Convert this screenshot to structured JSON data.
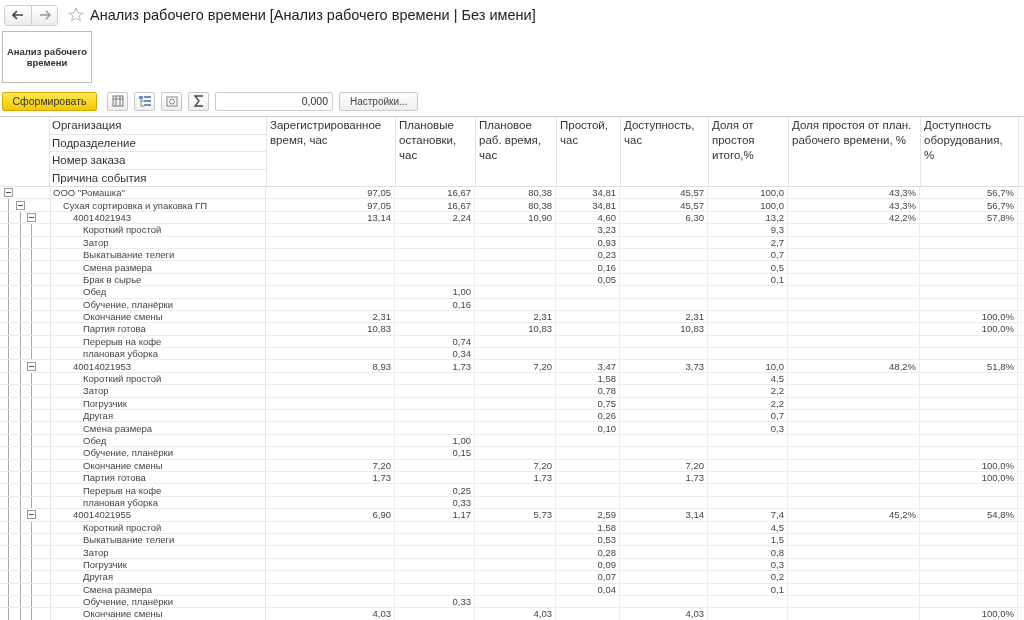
{
  "window": {
    "title": "Анализ рабочего времени [Анализ рабочего времени | Без имени]"
  },
  "variant_button": "Анализ рабочего времени",
  "toolbar": {
    "generate": "Сформировать",
    "sum_field": "0,000",
    "settings": "Настройки..."
  },
  "table": {
    "group_headers": [
      "Организация",
      "Подразделение",
      "Номер заказа",
      "Причина события"
    ],
    "columns": [
      "Зарегистрированное время, час",
      "Плановые остановки, час",
      "Плановое раб. время, час",
      "Простой, час",
      "Доступность, час",
      "Доля от простоя итого,%",
      "Доля простоя от план. рабочего времени, %",
      "Доступность оборудования, %"
    ],
    "rows": [
      {
        "label": "ООО \"Ромашка\"",
        "kind": "total",
        "expanded": true,
        "values": [
          "97,05",
          "16,67",
          "80,38",
          "34,81",
          "45,57",
          "100,0",
          "43,3%",
          "56,7%"
        ],
        "children": [
          {
            "label": "Сухая сортировка и упаковка ГП",
            "kind": "total",
            "expanded": true,
            "values": [
              "97,05",
              "16,67",
              "80,38",
              "34,81",
              "45,57",
              "100,0",
              "43,3%",
              "56,7%"
            ],
            "children": [
              {
                "label": "40014021943",
                "kind": "total",
                "expanded": true,
                "values": [
                  "13,14",
                  "2,24",
                  "10,90",
                  "4,60",
                  "6,30",
                  "13,2",
                  "42,2%",
                  "57,8%"
                ],
                "children": [
                  {
                    "label": "Короткий простой",
                    "kind": "downtime",
                    "values": [
                      "3,23",
                      "9,3"
                    ]
                  },
                  {
                    "label": "Затор",
                    "kind": "downtime",
                    "values": [
                      "0,93",
                      "2,7"
                    ]
                  },
                  {
                    "label": "Выкатывание телеги",
                    "kind": "downtime",
                    "values": [
                      "0,23",
                      "0,7"
                    ]
                  },
                  {
                    "label": "Смена размера",
                    "kind": "downtime",
                    "values": [
                      "0,16",
                      "0,5"
                    ]
                  },
                  {
                    "label": "Брак в сырье",
                    "kind": "downtime",
                    "values": [
                      "0,05",
                      "0,1"
                    ]
                  },
                  {
                    "label": "Обед",
                    "kind": "stop",
                    "values": [
                      "1,00"
                    ]
                  },
                  {
                    "label": "Обучение, планёрки",
                    "kind": "stop",
                    "values": [
                      "0,16"
                    ]
                  },
                  {
                    "label": "Окончание смены",
                    "kind": "work",
                    "values": [
                      "2,31",
                      "2,31",
                      "2,31",
                      "100,0%"
                    ]
                  },
                  {
                    "label": "Партия готова",
                    "kind": "work",
                    "values": [
                      "10,83",
                      "10,83",
                      "10,83",
                      "100,0%"
                    ]
                  },
                  {
                    "label": "Перерыв на кофе",
                    "kind": "stop",
                    "values": [
                      "0,74"
                    ]
                  },
                  {
                    "label": "плановая уборка",
                    "kind": "stop",
                    "values": [
                      "0,34"
                    ]
                  }
                ]
              },
              {
                "label": "40014021953",
                "kind": "total",
                "expanded": true,
                "values": [
                  "8,93",
                  "1,73",
                  "7,20",
                  "3,47",
                  "3,73",
                  "10,0",
                  "48,2%",
                  "51,8%"
                ],
                "children": [
                  {
                    "label": "Короткий простой",
                    "kind": "downtime",
                    "values": [
                      "1,58",
                      "4,5"
                    ]
                  },
                  {
                    "label": "Затор",
                    "kind": "downtime",
                    "values": [
                      "0,78",
                      "2,2"
                    ]
                  },
                  {
                    "label": "Погрузчик",
                    "kind": "downtime",
                    "values": [
                      "0,75",
                      "2,2"
                    ]
                  },
                  {
                    "label": "Другая",
                    "kind": "downtime",
                    "values": [
                      "0,26",
                      "0,7"
                    ]
                  },
                  {
                    "label": "Смена размера",
                    "kind": "downtime",
                    "values": [
                      "0,10",
                      "0,3"
                    ]
                  },
                  {
                    "label": "Обед",
                    "kind": "stop",
                    "values": [
                      "1,00"
                    ]
                  },
                  {
                    "label": "Обучение, планёрки",
                    "kind": "stop",
                    "values": [
                      "0,15"
                    ]
                  },
                  {
                    "label": "Окончание смены",
                    "kind": "work",
                    "values": [
                      "7,20",
                      "7,20",
                      "7,20",
                      "100,0%"
                    ]
                  },
                  {
                    "label": "Партия готова",
                    "kind": "work",
                    "values": [
                      "1,73",
                      "1,73",
                      "1,73",
                      "100,0%"
                    ]
                  },
                  {
                    "label": "Перерыв на кофе",
                    "kind": "stop",
                    "values": [
                      "0,25"
                    ]
                  },
                  {
                    "label": "плановая уборка",
                    "kind": "stop",
                    "values": [
                      "0,33"
                    ]
                  }
                ]
              },
              {
                "label": "40014021955",
                "kind": "total",
                "expanded": true,
                "values": [
                  "6,90",
                  "1,17",
                  "5,73",
                  "2,59",
                  "3,14",
                  "7,4",
                  "45,2%",
                  "54,8%"
                ],
                "children": [
                  {
                    "label": "Короткий простой",
                    "kind": "downtime",
                    "values": [
                      "1,58",
                      "4,5"
                    ]
                  },
                  {
                    "label": "Выкатывание телеги",
                    "kind": "downtime",
                    "values": [
                      "0,53",
                      "1,5"
                    ]
                  },
                  {
                    "label": "Затор",
                    "kind": "downtime",
                    "values": [
                      "0,28",
                      "0,8"
                    ]
                  },
                  {
                    "label": "Погрузчик",
                    "kind": "downtime",
                    "values": [
                      "0,09",
                      "0,3"
                    ]
                  },
                  {
                    "label": "Другая",
                    "kind": "downtime",
                    "values": [
                      "0,07",
                      "0,2"
                    ]
                  },
                  {
                    "label": "Смена размера",
                    "kind": "downtime",
                    "values": [
                      "0,04",
                      "0,1"
                    ]
                  },
                  {
                    "label": "Обучение, планёрки",
                    "kind": "stop",
                    "values": [
                      "0,33"
                    ]
                  },
                  {
                    "label": "Окончание смены",
                    "kind": "work",
                    "values": [
                      "4,03",
                      "4,03",
                      "4,03",
                      "100,0%"
                    ]
                  }
                ]
              }
            ]
          }
        ]
      }
    ]
  }
}
